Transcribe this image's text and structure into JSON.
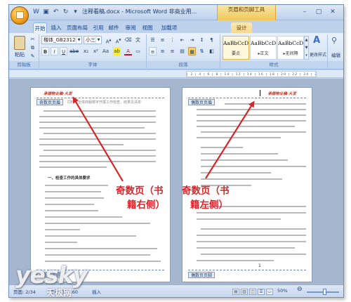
{
  "window": {
    "title": "注释看稿.docx - Microsoft Word 非商业用...",
    "context_tab_group": "页眉和页脚工具"
  },
  "ribbon_tabs": [
    "开始",
    "插入",
    "页面布局",
    "引用",
    "邮件",
    "审阅",
    "视图",
    "加载项"
  ],
  "context_tab": "设计",
  "ribbon": {
    "paste_label": "粘贴",
    "font_name": "楷体_GB2312",
    "font_size": "小三",
    "group_labels": {
      "clipboard": "剪贴板",
      "font": "字体",
      "paragraph": "段落",
      "styles": "样式",
      "editing": "编辑"
    },
    "styles": [
      {
        "sample": "AaBbCcDd",
        "name": "要点"
      },
      {
        "sample": "AaBbCcDd",
        "name": "▸正文"
      },
      {
        "sample": "AaBbCcDd",
        "name": "▸无间隔"
      }
    ],
    "change_styles_label": "更改样式",
    "editing_label": "编辑"
  },
  "document": {
    "left_page": {
      "header_text": "承德物业稿·大发",
      "header_tag": "奇数页页眉",
      "footer_tag": "奇数页页脚",
      "section_heading": "一、检查工作的具体要求",
      "body_fragment": "同时对全体商服楼宇开展工作检查，结果见清单"
    },
    "right_page": {
      "header_text": "承德物业稿·大发",
      "header_tag": "偶数页页眉",
      "footer_tag": "偶数页页脚",
      "page_number": "1"
    }
  },
  "annotations": {
    "odd_label_line1": "奇数页（书",
    "odd_label_line2": "籍右侧）",
    "even_label_line1": "奇数页（书",
    "even_label_line2": "籍左侧）",
    "arrow_color": "#d6262a"
  },
  "status_bar": {
    "page": "页面: 2/34",
    "words": "字数: 12,160",
    "insert_mode": "插入",
    "zoom": "50%"
  },
  "watermark": {
    "text": "yesky",
    "subtext": "天极网"
  },
  "colors": {
    "ribbon_blue": "#bfd2ec",
    "workspace": "#a5b6cf",
    "header_red": "#c0392b",
    "annotation_red": "#d6262a"
  }
}
